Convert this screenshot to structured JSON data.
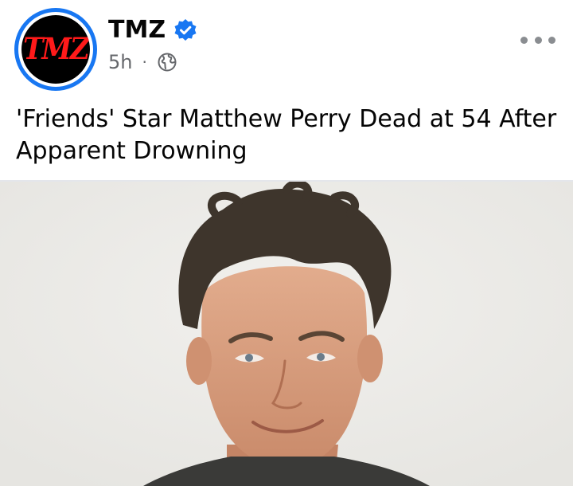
{
  "post": {
    "page_name": "TMZ",
    "verified": true,
    "time": "5h",
    "audience_icon": "globe-icon",
    "more_icon": "more-options-icon",
    "headline": "'Friends' Star Matthew Perry Dead at 54 After Apparent Drowning",
    "logo_text": "TMZ"
  },
  "colors": {
    "brand_blue": "#1877f2",
    "logo_red": "#ff1a1a",
    "text_primary": "#050505",
    "text_secondary": "#65676b"
  }
}
